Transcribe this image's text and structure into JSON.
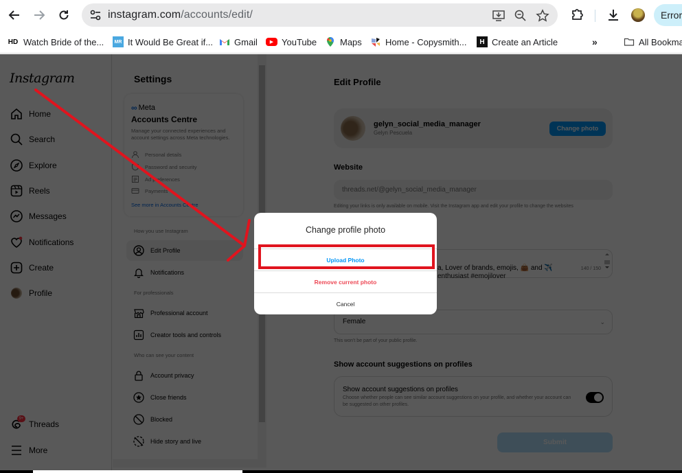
{
  "browser": {
    "url_host": "instagram.com",
    "url_path": "/accounts/edit/",
    "profile_status": "Error",
    "bookmarks": [
      {
        "label": "Watch Bride of the...",
        "icon": "hd-icon",
        "badge": "HD"
      },
      {
        "label": "It Would Be Great if...",
        "icon": "mr-icon",
        "badge": "MR"
      },
      {
        "label": "Gmail",
        "icon": "gmail-icon",
        "badge": "M"
      },
      {
        "label": "YouTube",
        "icon": "youtube-icon",
        "badge": "▶"
      },
      {
        "label": "Maps",
        "icon": "maps-icon",
        "badge": ""
      },
      {
        "label": "Home - Copysmith...",
        "icon": "copysmith-icon",
        "badge": ""
      },
      {
        "label": "Create an Article",
        "icon": "h-icon",
        "badge": "H"
      }
    ],
    "overflow_label": "»",
    "all_bookmarks_label": "All Bookmarks"
  },
  "instagram": {
    "logo": "Instagram",
    "nav": [
      {
        "label": "Home",
        "icon": "home-icon"
      },
      {
        "label": "Search",
        "icon": "search-icon"
      },
      {
        "label": "Explore",
        "icon": "compass-icon"
      },
      {
        "label": "Reels",
        "icon": "reels-icon"
      },
      {
        "label": "Messages",
        "icon": "messenger-icon"
      },
      {
        "label": "Notifications",
        "icon": "heart-icon"
      },
      {
        "label": "Create",
        "icon": "plus-square-icon"
      },
      {
        "label": "Profile",
        "icon": "avatar-icon"
      }
    ],
    "nav_bottom": [
      {
        "label": "Threads",
        "icon": "threads-icon",
        "badge": "9+"
      },
      {
        "label": "More",
        "icon": "menu-icon"
      }
    ]
  },
  "settings": {
    "title": "Settings",
    "accounts_centre": {
      "brand": "Meta",
      "title": "Accounts Centre",
      "description": "Manage your connected experiences and account settings across Meta technologies.",
      "items": [
        "Personal details",
        "Password and security",
        "Ad preferences",
        "Payments"
      ],
      "link": "See more in Accounts Centre"
    },
    "sections": [
      {
        "heading": "How you use Instagram",
        "items": [
          {
            "label": "Edit Profile",
            "icon": "user-circle-icon",
            "active": true
          },
          {
            "label": "Notifications",
            "icon": "bell-icon"
          }
        ]
      },
      {
        "heading": "For professionals",
        "items": [
          {
            "label": "Professional account",
            "icon": "shop-icon"
          },
          {
            "label": "Creator tools and controls",
            "icon": "chart-icon"
          }
        ]
      },
      {
        "heading": "Who can see your content",
        "items": [
          {
            "label": "Account privacy",
            "icon": "lock-icon"
          },
          {
            "label": "Close friends",
            "icon": "star-circle-icon"
          },
          {
            "label": "Blocked",
            "icon": "blocked-icon"
          },
          {
            "label": "Hide story and live",
            "icon": "hide-story-icon"
          }
        ]
      }
    ]
  },
  "edit_profile": {
    "title": "Edit Profile",
    "username": "gelyn_social_media_manager",
    "full_name": "Gelyn Pescuela",
    "change_photo_label": "Change photo",
    "website_label": "Website",
    "website_value": "threads.net/@gelyn_social_media_manager",
    "website_hint": "Editing your links is only available on mobile. Visit the Instagram app and edit your profile to change the websites",
    "bio_line1": "a, Lover of brands, emojis, 👜 and ✈️",
    "bio_line2": "enthusiast #emojilover",
    "bio_count": "140 / 150",
    "gender_value": "Female",
    "gender_hint": "This won't be part of your public profile.",
    "suggestions_heading": "Show account suggestions on profiles",
    "suggestions_title": "Show account suggestions on profiles",
    "suggestions_desc": "Choose whether people can see similar account suggestions on your profile, and whether your account can be suggested on other profiles.",
    "suggestions_enabled": true,
    "submit_label": "Submit"
  },
  "modal": {
    "title": "Change profile photo",
    "upload_label": "Upload Photo",
    "remove_label": "Remove current photo",
    "cancel_label": "Cancel"
  },
  "colors": {
    "accent_blue": "#0095f6",
    "danger_red": "#ed4956",
    "annotation_red": "#e0141e"
  }
}
